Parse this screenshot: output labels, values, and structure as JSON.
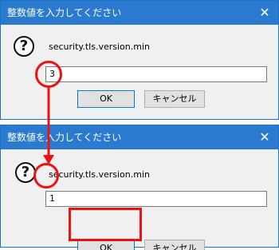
{
  "dialog_top": {
    "title": "整数値を入力してください",
    "prompt": "security.tls.version.min",
    "input_value": "3",
    "ok_label": "OK",
    "cancel_label": "キャンセル"
  },
  "dialog_bottom": {
    "title": "整数値を入力してください",
    "prompt": "security.tls.version.min",
    "input_value": "1",
    "ok_label": "OK",
    "cancel_label": "キャンセル"
  },
  "icons": {
    "close": "✕",
    "question": "?"
  },
  "colors": {
    "titlebar": "#2a7ad0",
    "annotation": "#ee1111",
    "dialog_bg": "#f0f0f0"
  }
}
